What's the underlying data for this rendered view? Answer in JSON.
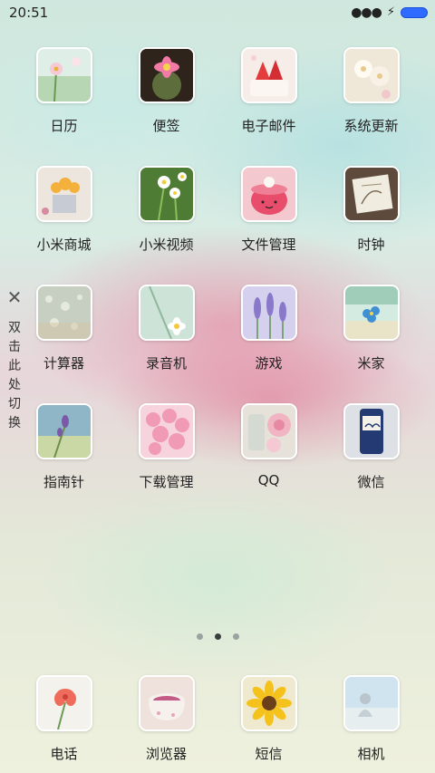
{
  "status_bar": {
    "time": "20:51",
    "more_icon": "dots-icon",
    "charging_icon": "bolt-icon",
    "battery_icon": "battery-icon",
    "battery_color": "#2f6bff"
  },
  "side_hint": {
    "close_icon": "close-icon",
    "text": "双击此处切换"
  },
  "apps": [
    {
      "label": "日历",
      "icon": "daisy-photo-icon",
      "theme": "#e8f0e8"
    },
    {
      "label": "便签",
      "icon": "cactus-flower-icon",
      "theme": "#3a2a20"
    },
    {
      "label": "电子邮件",
      "icon": "strawberry-cake-icon",
      "theme": "#f4e4e0"
    },
    {
      "label": "系统更新",
      "icon": "white-flowers-icon",
      "theme": "#efe6d6"
    },
    {
      "label": "小米商城",
      "icon": "flower-basket-icon",
      "theme": "#e9e3dc"
    },
    {
      "label": "小米视频",
      "icon": "daisies-field-icon",
      "theme": "#5d8a3f"
    },
    {
      "label": "文件管理",
      "icon": "pink-cup-icon",
      "theme": "#f2b8c0"
    },
    {
      "label": "时钟",
      "icon": "vintage-stamp-icon",
      "theme": "#6a5445"
    },
    {
      "label": "计算器",
      "icon": "dew-glass-icon",
      "theme": "#c9d3c8"
    },
    {
      "label": "录音机",
      "icon": "white-flower-icon",
      "theme": "#cfe3d6"
    },
    {
      "label": "游戏",
      "icon": "lavender-icon",
      "theme": "#c9c4e6"
    },
    {
      "label": "米家",
      "icon": "forget-me-not-icon",
      "theme": "#cfe6e0"
    },
    {
      "label": "指南针",
      "icon": "lavender-sprig-icon",
      "theme": "#8cb3c4"
    },
    {
      "label": "下载管理",
      "icon": "pink-hydrangea-icon",
      "theme": "#f4c6d4"
    },
    {
      "label": "QQ",
      "icon": "pink-rose-icon",
      "theme": "#e7e2da"
    },
    {
      "label": "微信",
      "icon": "swan-bottle-icon",
      "theme": "#d8dce0"
    }
  ],
  "pager": {
    "pages": 3,
    "active": 2
  },
  "dock": [
    {
      "label": "电话",
      "icon": "red-flower-icon",
      "theme": "#f3f1ec"
    },
    {
      "label": "浏览器",
      "icon": "tea-cup-icon",
      "theme": "#efe2dc"
    },
    {
      "label": "短信",
      "icon": "sunflower-icon",
      "theme": "#f0ead0"
    },
    {
      "label": "相机",
      "icon": "seaside-girl-icon",
      "theme": "#cfe3ec"
    }
  ]
}
